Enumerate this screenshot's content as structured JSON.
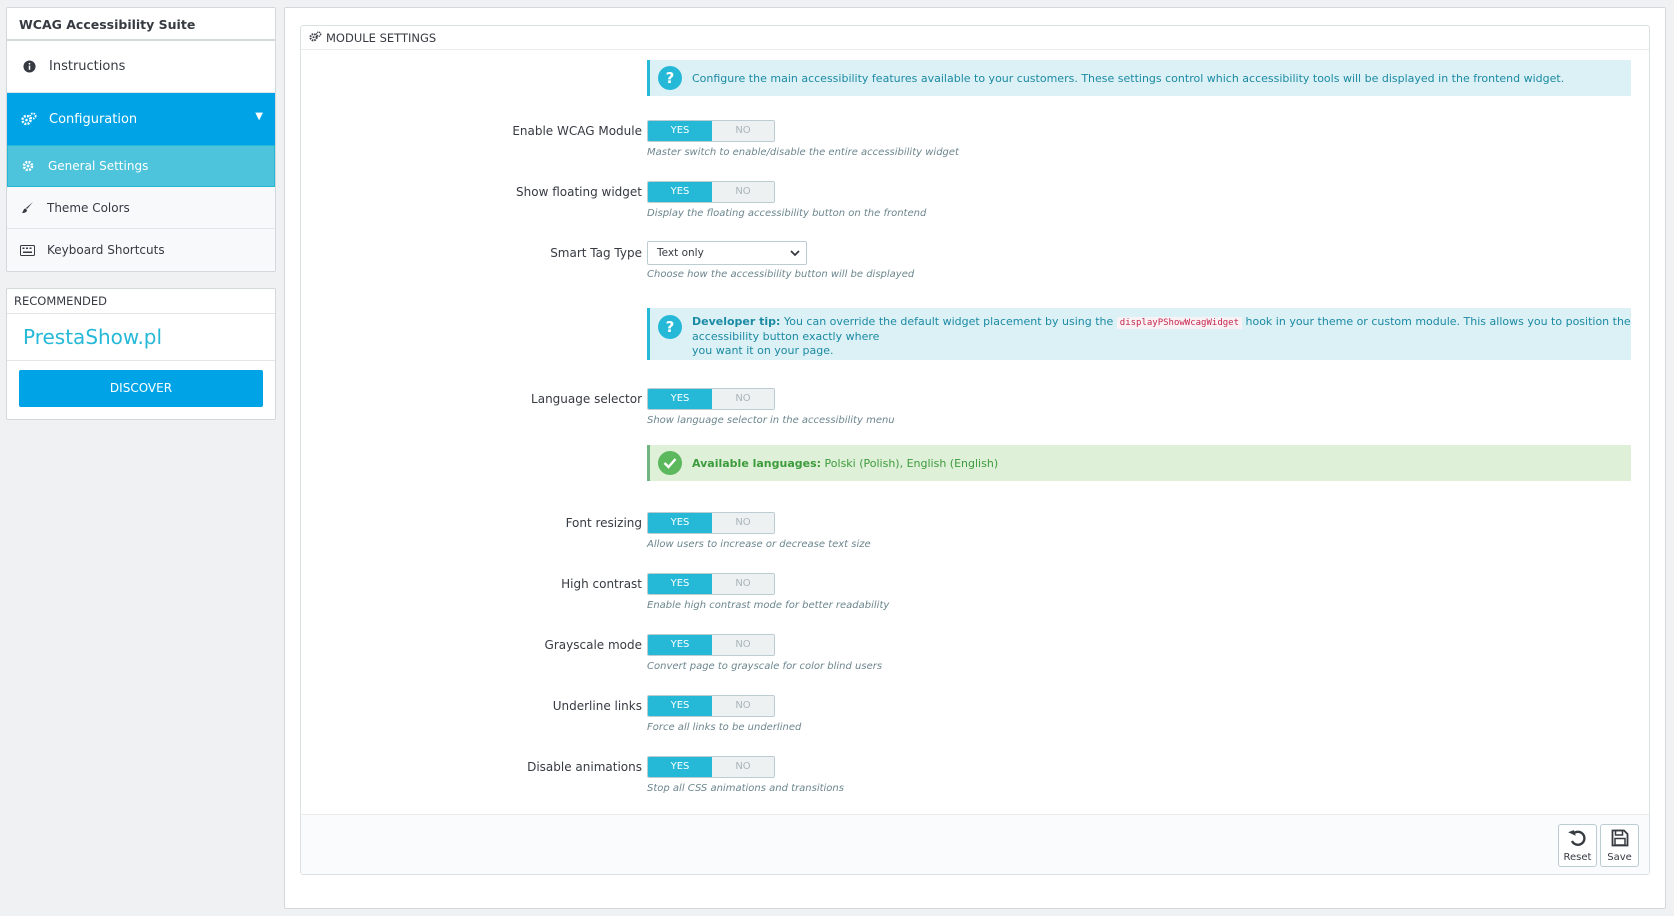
{
  "sidebar": {
    "title": "WCAG Accessibility Suite",
    "items": [
      {
        "label": "Instructions",
        "icon": "info-circle-icon"
      },
      {
        "label": "Configuration",
        "icon": "gears-icon"
      }
    ],
    "subitems": [
      {
        "label": "General Settings",
        "icon": "gear-icon"
      },
      {
        "label": "Theme Colors",
        "icon": "brush-icon"
      },
      {
        "label": "Keyboard Shortcuts",
        "icon": "keyboard-icon"
      }
    ],
    "recommended": {
      "heading": "RECOMMENDED",
      "brand": "PrestaShow.pl",
      "button": "DISCOVER"
    }
  },
  "panel": {
    "title": "MODULE SETTINGS",
    "intro_alert": "Configure the main accessibility features available to your customers. These settings control which accessibility tools will be displayed in the frontend widget.",
    "dev_tip": {
      "bold": "Developer tip:",
      "before": " You can override the default widget placement by using the ",
      "code": "displayPShowWcagWidget",
      "after": " hook in your theme or custom module. This allows you to position the accessibility button exactly where",
      "line2": "you want it on your page."
    },
    "languages_alert": {
      "bold": "Available languages:",
      "text": " Polski (Polish), English (English)"
    },
    "toggle_yes": "YES",
    "toggle_no": "NO",
    "fields": {
      "enable_wcag": {
        "label": "Enable WCAG Module",
        "help": "Master switch to enable/disable the entire accessibility widget",
        "value": "YES"
      },
      "floating_widget": {
        "label": "Show floating widget",
        "help": "Display the floating accessibility button on the frontend",
        "value": "YES"
      },
      "smart_tag": {
        "label": "Smart Tag Type",
        "value": "Text only",
        "help": "Choose how the accessibility button will be displayed"
      },
      "language_selector": {
        "label": "Language selector",
        "help": "Show language selector in the accessibility menu",
        "value": "YES"
      },
      "font_resizing": {
        "label": "Font resizing",
        "help": "Allow users to increase or decrease text size",
        "value": "YES"
      },
      "high_contrast": {
        "label": "High contrast",
        "help": "Enable high contrast mode for better readability",
        "value": "YES"
      },
      "grayscale": {
        "label": "Grayscale mode",
        "help": "Convert page to grayscale for color blind users",
        "value": "YES"
      },
      "underline_links": {
        "label": "Underline links",
        "help": "Force all links to be underlined",
        "value": "YES"
      },
      "disable_animations": {
        "label": "Disable animations",
        "help": "Stop all CSS animations and transitions",
        "value": "YES"
      }
    },
    "footer": {
      "reset": "Reset",
      "save": "Save"
    }
  },
  "colors": {
    "primary": "#25b9d7",
    "active_nav": "#00a4e6",
    "success": "#5cb85c"
  }
}
